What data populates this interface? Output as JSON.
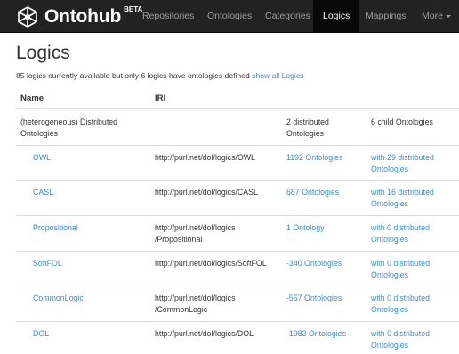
{
  "brand": {
    "name": "Ontohub",
    "badge": "BETA"
  },
  "nav": {
    "items": [
      {
        "label": "Repositories"
      },
      {
        "label": "Ontologies"
      },
      {
        "label": "Categories"
      },
      {
        "label": "Logics"
      },
      {
        "label": "Mappings"
      },
      {
        "label": "More"
      }
    ],
    "active": "Logics"
  },
  "page": {
    "title": "Logics",
    "summary": "85 logics currently available but only 6 logics have ontologies defined",
    "show_all_link": "show all Logics"
  },
  "table": {
    "headers": {
      "name": "Name",
      "iri": "IRI"
    },
    "group_row": {
      "name": "(heterogeneous) Distributed Ontologies",
      "count": "2 distributed Ontologies",
      "child": "6 child Ontologies"
    },
    "rows": [
      {
        "name": "OWL",
        "iri": "http://purl.net/dol/logics/OWL",
        "ontologies": "1192 Ontologies",
        "distributed": "with 29 distributed Ontologies"
      },
      {
        "name": "CASL",
        "iri": "http://purl.net/dol/logics/CASL",
        "ontologies": "687 Ontologies",
        "distributed": "with 16 distributed Ontologies"
      },
      {
        "name": "Propositional",
        "iri": "http://purl.net/dol/logics /Propositional",
        "ontologies": "1 Ontology",
        "distributed": "with 0 distributed Ontologies"
      },
      {
        "name": "SoftFOL",
        "iri": "http://purl.net/dol/logics/SoftFOL",
        "ontologies": "-340 Ontologies",
        "distributed": "with 0 distributed Ontologies"
      },
      {
        "name": "CommonLogic",
        "iri": "http://purl.net/dol/logics /CommonLogic",
        "ontologies": "-557 Ontologies",
        "distributed": "with 0 distributed Ontologies"
      },
      {
        "name": "DOL",
        "iri": "http://purl.net/dol/logics/DOL",
        "ontologies": "-1983 Ontologies",
        "distributed": "with 0 distributed Ontologies"
      }
    ]
  },
  "colors": {
    "navbar": "#222222",
    "link": "#428bca",
    "text": "#333333",
    "nav_text": "#9d9d9d"
  }
}
